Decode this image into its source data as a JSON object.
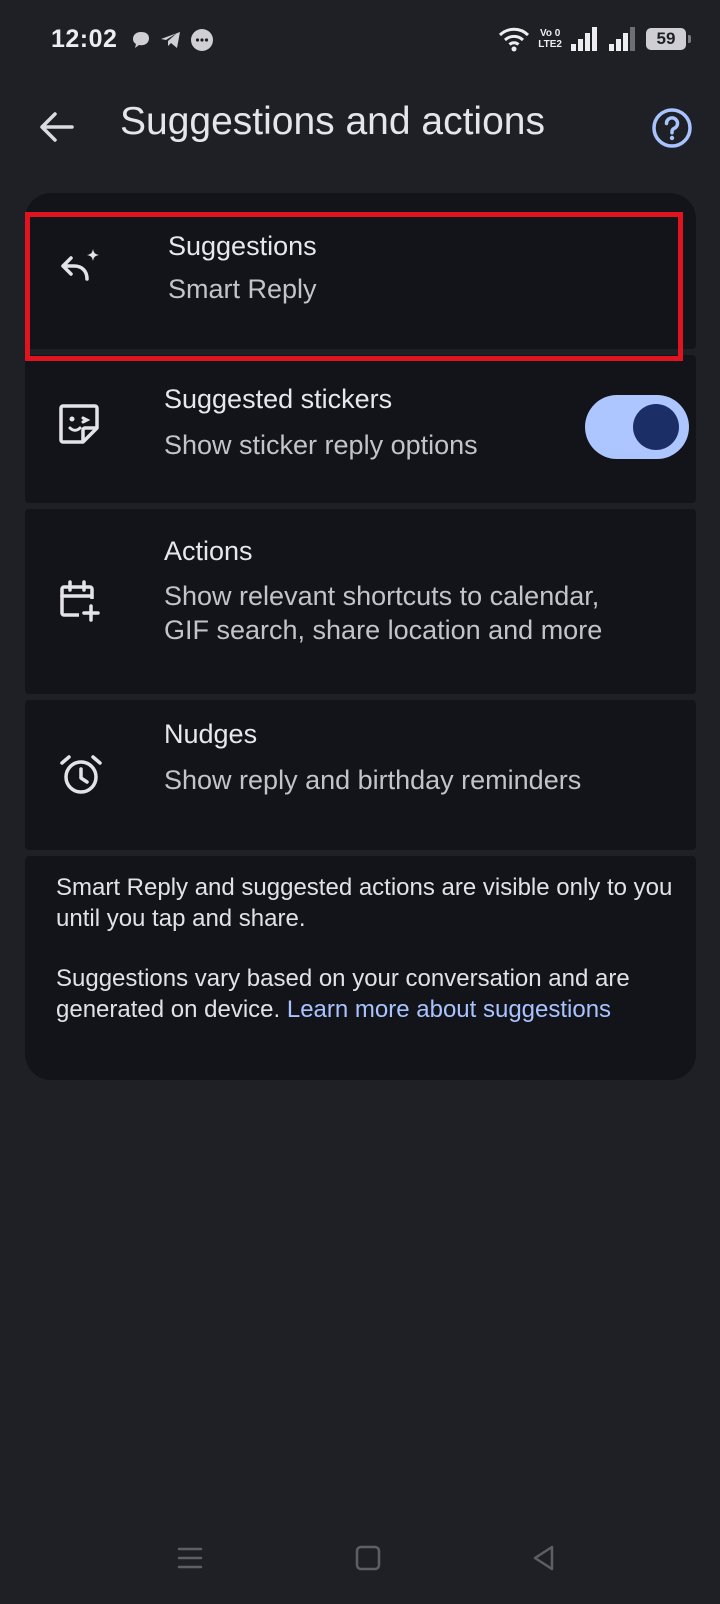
{
  "status_bar": {
    "time": "12:02",
    "volte_top": "Vo 0",
    "volte_bottom": "LTE2",
    "battery": "59"
  },
  "app_bar": {
    "title": "Suggestions and actions",
    "back_icon": "arrow-back-icon",
    "help_icon": "help-circle-icon"
  },
  "settings": [
    {
      "title": "Suggestions",
      "subtitle": "Smart Reply",
      "icon": "reply-sparkle-icon"
    },
    {
      "title": "Suggested stickers",
      "subtitle": "Show sticker reply options",
      "icon": "sticker-icon",
      "toggle_on": true
    },
    {
      "title": "Actions",
      "subtitle_line1": "Show relevant shortcuts to calendar,",
      "subtitle_line2": "GIF search, share location and more",
      "icon": "calendar-add-icon"
    },
    {
      "title": "Nudges",
      "subtitle": "Show reply and birthday reminders",
      "icon": "alarm-icon"
    }
  ],
  "info": {
    "para1": "Smart Reply and suggested actions are visible only to you until you tap and share.",
    "para2": "Suggestions vary based on your conversation and are generated on device.",
    "link": "Learn more about suggestions"
  },
  "colors": {
    "background": "#1f2026",
    "card": "#13141a",
    "accent": "#adc6ff",
    "highlight": "#e0141e"
  }
}
